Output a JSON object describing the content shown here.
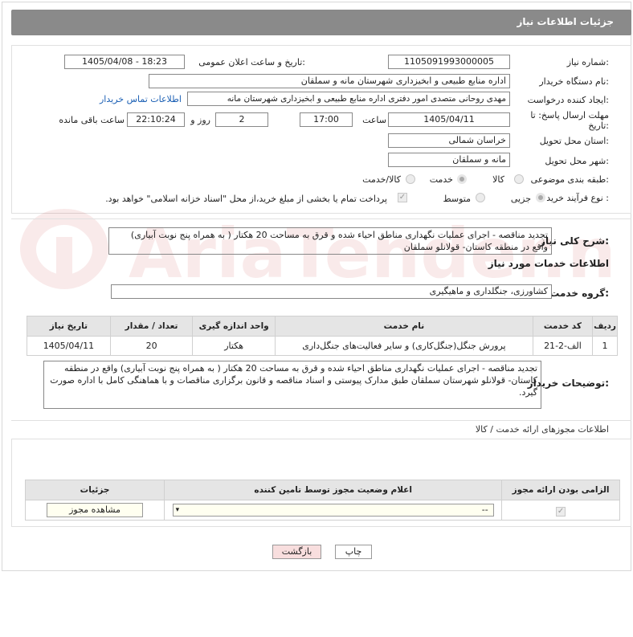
{
  "header": {
    "title": "جزئیات اطلاعات نیاز"
  },
  "fields": {
    "need_number_label": "شماره نیاز:",
    "need_number": "1105091993000005",
    "announce_label": "تاریخ و ساعت اعلان عمومی:",
    "announce_value": "1405/04/08 - 18:23",
    "buyer_org_label": "نام دستگاه خریدار:",
    "buyer_org": "اداره منابع طبیعی و ابخیزداری شهرستان مانه و سملقان",
    "creator_label": "ایجاد کننده درخواست:",
    "creator": "مهدی روحانی متصدی امور دفتری اداره منابع طبیعی و ابخیزداری شهرستان مانه",
    "contact_link": "اطلاعات تماس خریدار",
    "deadline_label": "مهلت ارسال پاسخ: تا تاریخ:",
    "deadline_date": "1405/04/11",
    "time_label": "ساعت",
    "deadline_time": "17:00",
    "days_value": "2",
    "days_label": "روز و",
    "remaining_time": "22:10:24",
    "remaining_label": "ساعت باقی مانده",
    "province_label": "استان محل تحویل:",
    "province": "خراسان شمالی",
    "city_label": "شهر محل تحویل:",
    "city": "مانه و سملقان",
    "category_label": "طبقه بندی موضوعی:",
    "category_options": [
      "کالا",
      "خدمت",
      "کالا/خدمت"
    ],
    "purchase_label": "نوع فرآیند خرید :",
    "purchase_options": [
      "جزیی",
      "متوسط"
    ],
    "payment_note": "پرداخت تمام یا بخشی از مبلغ خرید،از محل \"اسناد خزانه اسلامی\" خواهد بود."
  },
  "description": {
    "label": "شرح کلی نیاز:",
    "text": "تجدید مناقصه -  اجرای عملیات نگهداری مناطق احیاء شده و قرق به مساحت 20 هکتار ( به همراه پنج نوبت آبیاری)  واقع در منطقه کاستان- قولانلو سملقان"
  },
  "services": {
    "title": "اطلاعات خدمات مورد نیاز",
    "group_label": "گروه خدمت:",
    "group_value": "کشاورزی، جنگلداری و ماهیگیری",
    "columns": [
      "ردیف",
      "کد خدمت",
      "نام خدمت",
      "واحد اندازه گیری",
      "تعداد / مقدار",
      "تاریخ نیاز"
    ],
    "rows": [
      [
        "1",
        "الف-2-21",
        "پرورش جنگل(جنگل‌کاری) و سایر فعالیت‌های جنگل‌داری",
        "هکتار",
        "20",
        "1405/04/11"
      ]
    ]
  },
  "buyer_notes": {
    "label": "توضیحات خریدار:",
    "text": "تجدید مناقصه -  اجرای عملیات نگهداری مناطق احیاء شده و قرق به مساحت 20 هکتار ( به همراه پنج نوبت آبیاری)  واقع در منطقه کاستان- قولانلو شهرستان سملقان طبق مدارک پیوستی و اسناد مناقصه و قانون برگزاری مناقصات و با هماهنگی کامل با اداره صورت گیرد."
  },
  "permits": {
    "title": "اطلاعات مجوزهای ارائه خدمت / کالا",
    "columns": [
      "الزامی بودن ارائه مجوز",
      "اعلام وضعیت مجوز توسط تامین کننده",
      "جزئیات"
    ],
    "select_value": "--",
    "view_button": "مشاهده مجوز"
  },
  "buttons": {
    "print": "چاپ",
    "back": "بازگشت"
  },
  "watermark": "AriaTender.net",
  "colors": {
    "header_bg": "#8a8a8a",
    "link": "#1a5fb4",
    "back_bg": "#f8dede"
  }
}
